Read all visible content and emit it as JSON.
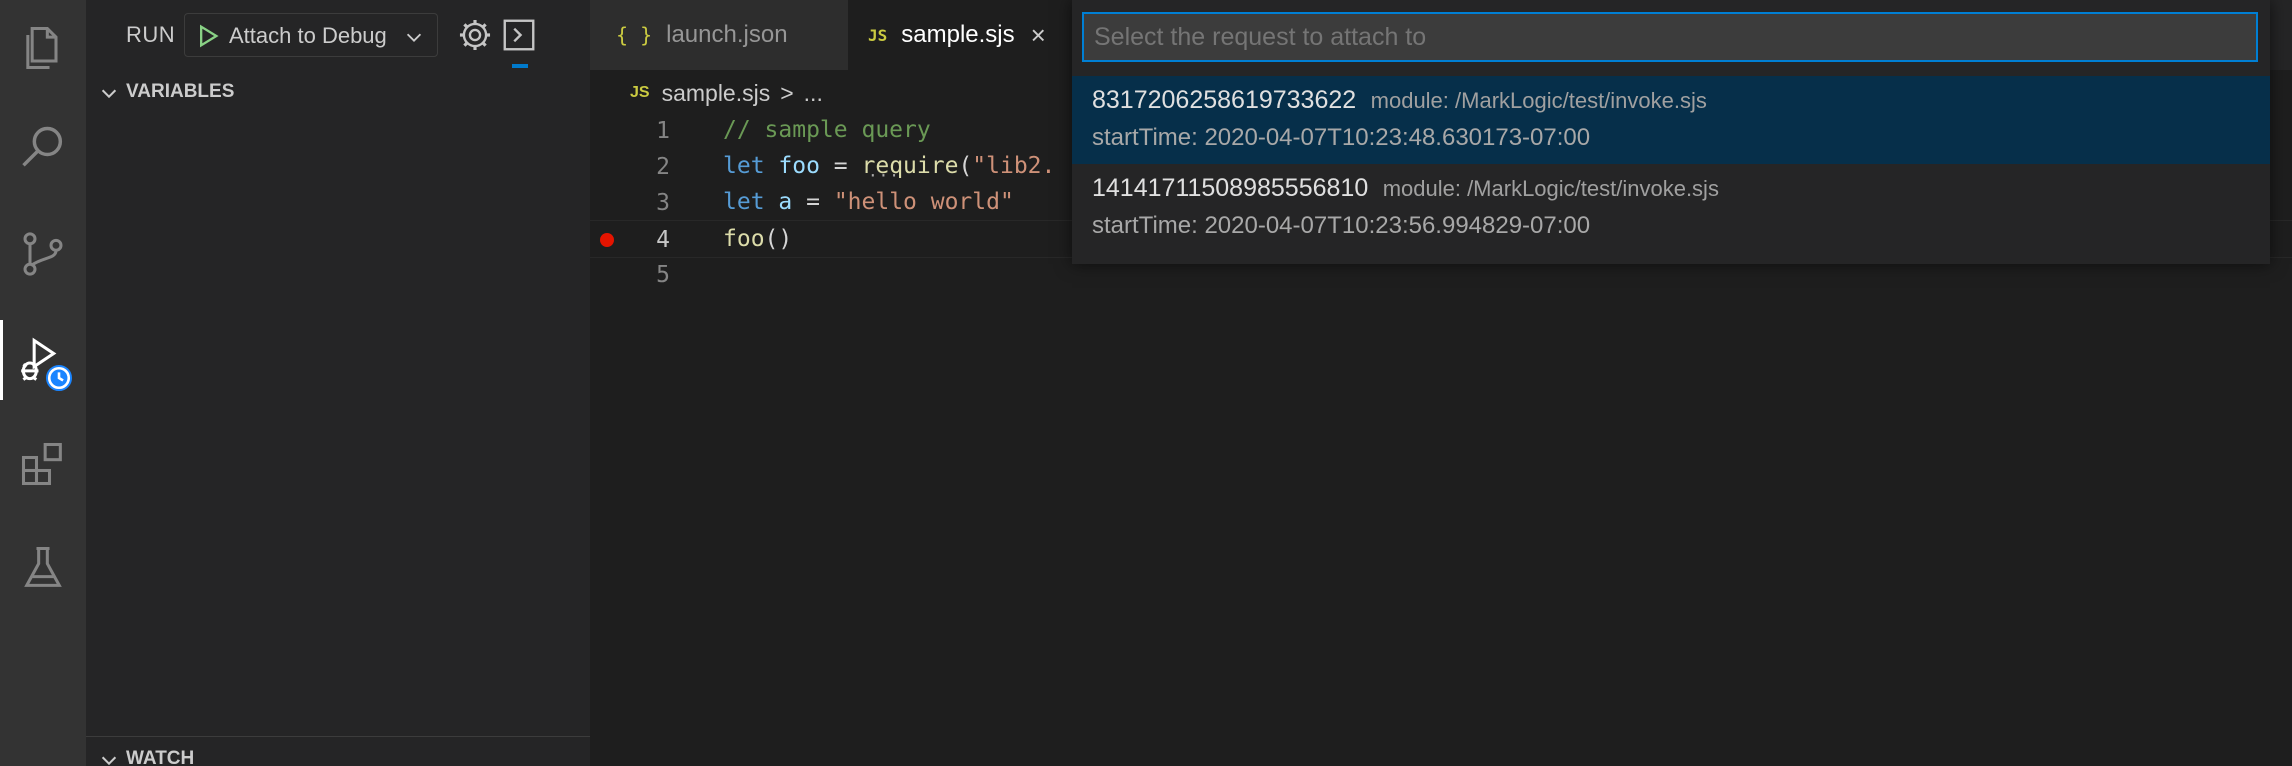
{
  "activity_bar": {
    "items": [
      {
        "name": "explorer-icon"
      },
      {
        "name": "search-icon"
      },
      {
        "name": "source-control-icon"
      },
      {
        "name": "run-debug-icon"
      },
      {
        "name": "extensions-icon"
      },
      {
        "name": "testing-icon"
      }
    ]
  },
  "sidebar": {
    "title": "RUN",
    "config_select": "Attach to Debug",
    "sections": {
      "variables": "VARIABLES",
      "watch": "WATCH"
    }
  },
  "tabs": [
    {
      "icon": "{ }",
      "label": "launch.json",
      "active": false
    },
    {
      "icon": "JS",
      "label": "sample.sjs",
      "active": true,
      "close": "×"
    }
  ],
  "breadcrumbs": {
    "icon": "JS",
    "file": "sample.sjs",
    "sep": ">",
    "more": "..."
  },
  "editor": {
    "lines": [
      {
        "num": "1",
        "text": "// sample query"
      },
      {
        "num": "2",
        "text": "let foo = require(\"lib2."
      },
      {
        "num": "3",
        "text": "let a = \"hello world\""
      },
      {
        "num": "4",
        "text": "foo()"
      },
      {
        "num": "5",
        "text": ""
      }
    ],
    "breakpoint_line": "4",
    "tokens": {
      "l1_comment": "// sample query",
      "l2_let": "let",
      "l2_foo": "foo",
      "l2_eq": " = ",
      "l2_require": "require",
      "l2_paren": "(",
      "l2_str": "\"lib2.",
      "l3_let": "let",
      "l3_a": "a",
      "l3_eq": " = ",
      "l3_str": "\"hello world\"",
      "l4_foo": "foo",
      "l4_parens": "()",
      "l2_dots": "···"
    }
  },
  "quick_pick": {
    "placeholder": "Select the request to attach to",
    "items": [
      {
        "id": "8317206258619733622",
        "module": "module: /MarkLogic/test/invoke.sjs",
        "start": "startTime: 2020-04-07T10:23:48.630173-07:00",
        "selected": true
      },
      {
        "id": "1414171150898555681​0",
        "module": "module: /MarkLogic/test/invoke.sjs",
        "start": "startTime: 2020-04-07T10:23:56.994829-07:00",
        "selected": false
      }
    ]
  },
  "colors": {
    "accent": "#007acc",
    "breakpoint": "#e51400",
    "selected_item": "#062f4a"
  }
}
